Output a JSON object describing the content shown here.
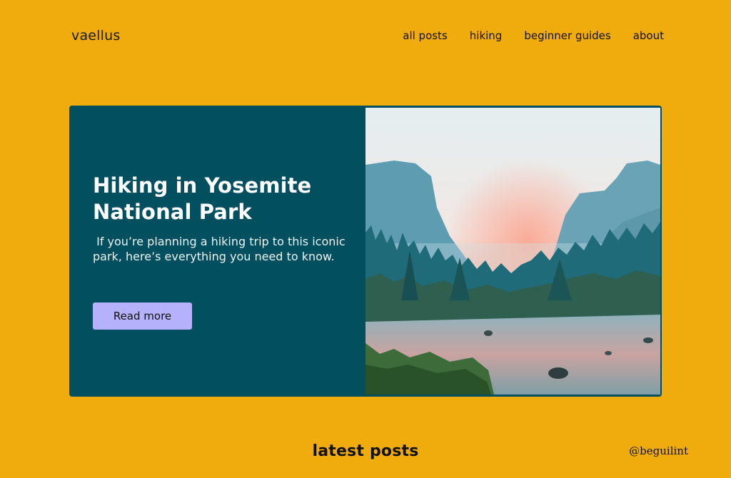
{
  "site": {
    "logo": "vaellus"
  },
  "nav": {
    "items": [
      {
        "label": "all posts"
      },
      {
        "label": "hiking"
      },
      {
        "label": "beginner guides"
      },
      {
        "label": "about"
      }
    ]
  },
  "hero": {
    "title": "Hiking in Yosemite National Park",
    "description": " If you’re planning a hiking trip to this iconic park, here’s everything you need to know.",
    "button_label": "Read more"
  },
  "latest": {
    "heading": "latest posts"
  },
  "credit": {
    "handle": "@beguilint"
  },
  "colors": {
    "background": "#F0AC0C",
    "hero_card": "#024F60",
    "button": "#B6B1FB"
  }
}
